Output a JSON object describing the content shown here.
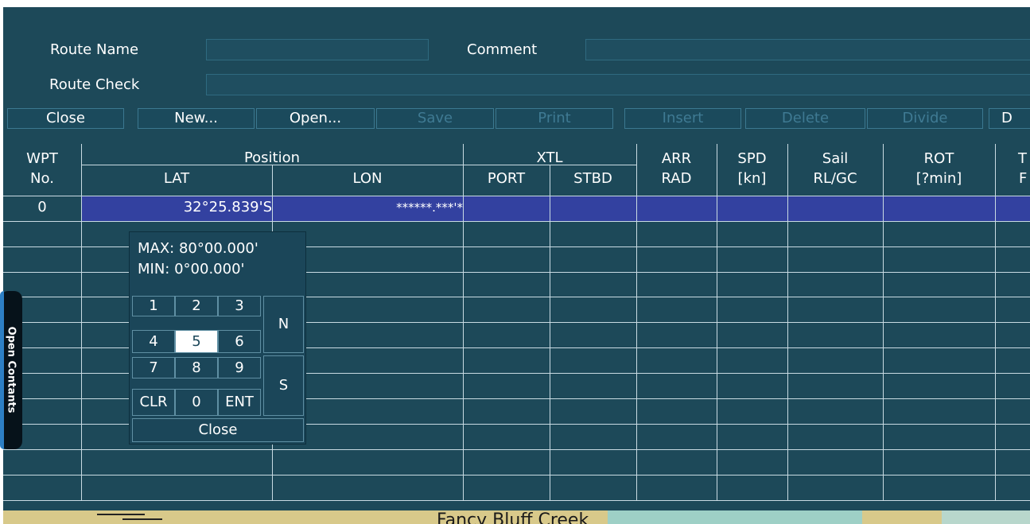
{
  "form": {
    "route_name_label": "Route Name",
    "route_name_value": "",
    "comment_label": "Comment",
    "comment_value": "",
    "route_check_label": "Route Check",
    "route_check_value": ""
  },
  "toolbar": {
    "close": "Close",
    "new": "New...",
    "open": "Open...",
    "save": "Save",
    "print": "Print",
    "insert": "Insert",
    "delete": "Delete",
    "divide": "Divide",
    "more": "D"
  },
  "colors": {
    "panel_bg": "#1d4959",
    "selected_row": "#3341a0",
    "disabled_text": "#3f7a93",
    "grid_line": "#c9dbe3"
  },
  "table": {
    "headers": {
      "wpt_top": "WPT",
      "wpt_bottom": "No.",
      "position": "Position",
      "lat": "LAT",
      "lon": "LON",
      "xtl": "XTL",
      "port": "PORT",
      "stbd": "STBD",
      "arr_top": "ARR",
      "arr_bottom": "RAD",
      "spd_top": "SPD",
      "spd_bottom": "[kn]",
      "sail_top": "Sail",
      "sail_bottom": "RL/GC",
      "rot_top": "ROT",
      "rot_bottom": "[?min]",
      "extra_top": "T",
      "extra_bottom": "F"
    },
    "rows": [
      {
        "no": "0",
        "lat": "32°25.839'S",
        "lon": "******.***'*"
      }
    ]
  },
  "side_tab": {
    "label": "Open Contants"
  },
  "keypad": {
    "max": "MAX: 80°00.000'",
    "min": "MIN: 0°00.000'",
    "keys": [
      "1",
      "2",
      "3",
      "4",
      "5",
      "6",
      "7",
      "8",
      "9",
      "CLR",
      "0",
      "ENT"
    ],
    "active_key": "5",
    "north": "N",
    "south": "S",
    "close": "Close"
  },
  "map": {
    "place_name": "Fancy Bluff Creek"
  },
  "icons": {
    "side_tab_icon": "drawer-handle-icon"
  }
}
